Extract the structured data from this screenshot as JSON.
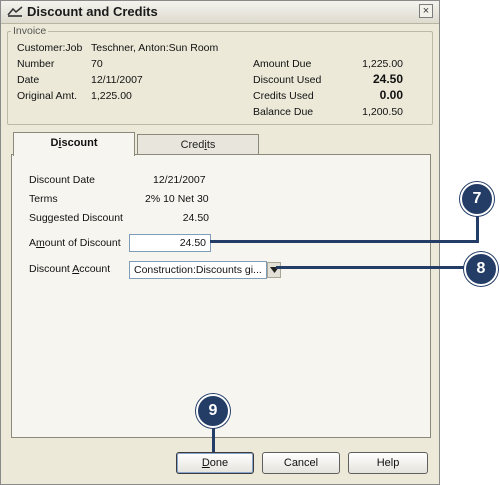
{
  "window": {
    "title": "Discount and Credits",
    "close_glyph": "×"
  },
  "invoice": {
    "legend": "Invoice",
    "customer_job_label": "Customer:Job",
    "customer_job_value": "Teschner, Anton:Sun Room",
    "number_label": "Number",
    "number_value": "70",
    "date_label": "Date",
    "date_value": "12/11/2007",
    "original_amt_label": "Original Amt.",
    "original_amt_value": "1,225.00",
    "amount_due_label": "Amount Due",
    "amount_due_value": "1,225.00",
    "discount_used_label": "Discount Used",
    "discount_used_value": "24.50",
    "credits_used_label": "Credits Used",
    "credits_used_value": "0.00",
    "balance_due_label": "Balance Due",
    "balance_due_value": "1,200.50"
  },
  "tabs": [
    {
      "label_pre": "D",
      "label_ul": "i",
      "label_post": "scount",
      "active": true
    },
    {
      "label_pre": "Cred",
      "label_ul": "i",
      "label_post": "ts",
      "active": false
    }
  ],
  "discount": {
    "discount_date_label": "Discount Date",
    "discount_date_value": "12/21/2007",
    "terms_label": "Terms",
    "terms_value": "2% 10 Net 30",
    "suggested_label": "Suggested Discount",
    "suggested_value": "24.50",
    "amount_label_pre": "A",
    "amount_label_ul": "m",
    "amount_label_post": "ount of Discount",
    "amount_value": "24.50",
    "account_label_pre": "Discount ",
    "account_label_ul": "A",
    "account_label_post": "ccount",
    "account_value": "Construction:Discounts gi..."
  },
  "buttons": {
    "done_ul": "D",
    "done_post": "one",
    "cancel": "Cancel",
    "help": "Help"
  },
  "callouts": {
    "c7": "7",
    "c8": "8",
    "c9": "9"
  },
  "colors": {
    "callout": "#233d67",
    "dialog_bg": "#ece9d8"
  }
}
